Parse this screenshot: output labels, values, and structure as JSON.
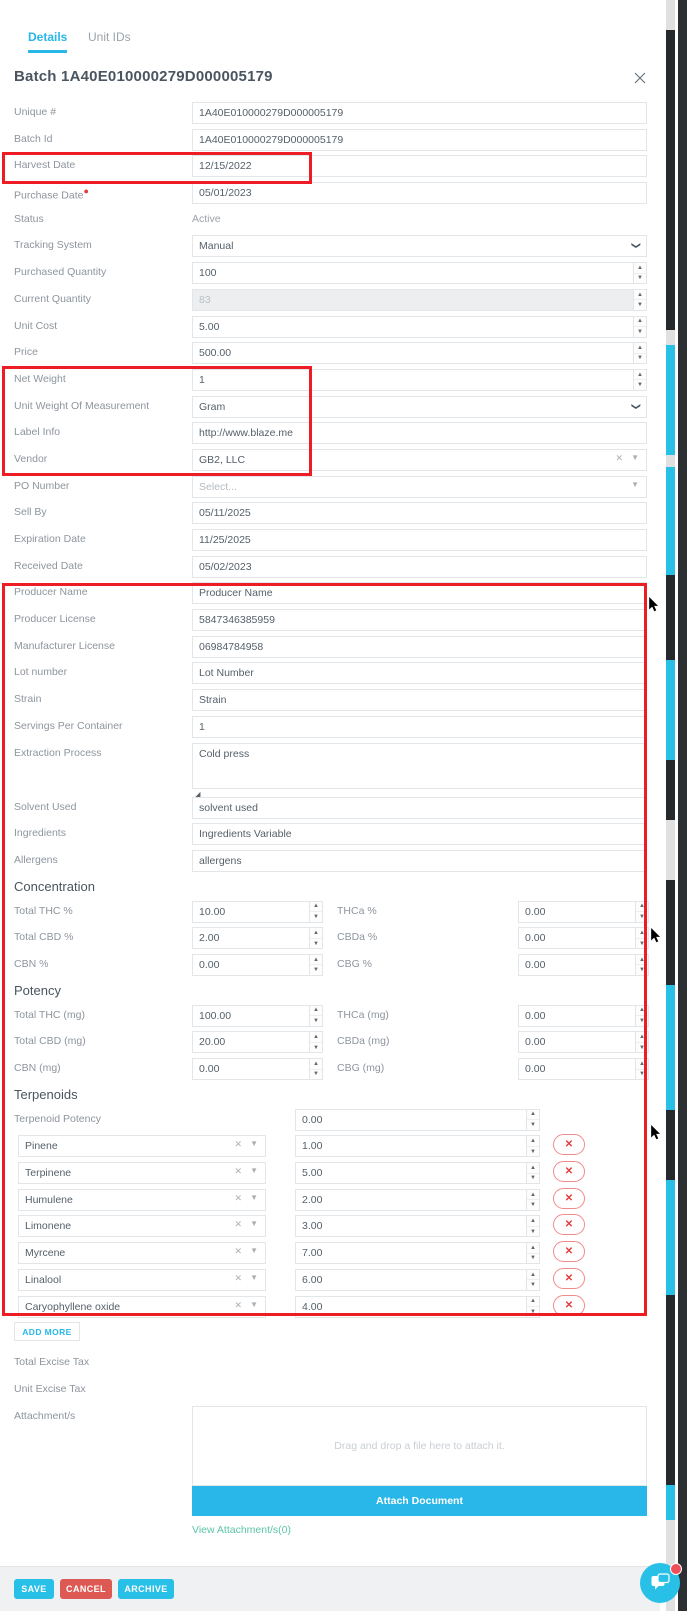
{
  "tabs": [
    {
      "label": "Details",
      "active": true
    },
    {
      "label": "Unit IDs",
      "active": false
    }
  ],
  "header": {
    "title": "Batch 1A40E010000279D000005179",
    "close_icon": "close-icon"
  },
  "fields": [
    {
      "label": "Unique #",
      "value": "1A40E010000279D000005179",
      "type": "text"
    },
    {
      "label": "Batch Id",
      "value": "1A40E010000279D000005179",
      "type": "text"
    },
    {
      "label": "Harvest Date",
      "value": "12/15/2022",
      "type": "text"
    },
    {
      "label": "Purchase Date",
      "value": "05/01/2023",
      "type": "text",
      "required": true
    },
    {
      "label": "Status",
      "value": "Active",
      "type": "static"
    },
    {
      "label": "Tracking System",
      "value": "Manual",
      "type": "select"
    },
    {
      "label": "Purchased Quantity",
      "value": "100",
      "type": "number"
    },
    {
      "label": "Current Quantity",
      "value": "83",
      "type": "number",
      "readonly": true
    },
    {
      "label": "Unit Cost",
      "value": "5.00",
      "type": "number"
    },
    {
      "label": "Price",
      "value": "500.00",
      "type": "number"
    },
    {
      "label": "Net Weight",
      "value": "1",
      "type": "number"
    },
    {
      "label": "Unit Weight Of Measurement",
      "value": "Gram",
      "type": "select"
    },
    {
      "label": "Label Info",
      "value": "http://www.blaze.me",
      "type": "text"
    },
    {
      "label": "Vendor",
      "value": "GB2, LLC",
      "type": "select2"
    },
    {
      "label": "PO Number",
      "value": "Select...",
      "type": "select3",
      "placeholder": true
    },
    {
      "label": "Sell By",
      "value": "05/11/2025",
      "type": "text"
    },
    {
      "label": "Expiration Date",
      "value": "11/25/2025",
      "type": "text"
    },
    {
      "label": "Received Date",
      "value": "05/02/2023",
      "type": "text"
    },
    {
      "label": "Producer Name",
      "value": "Producer Name",
      "type": "text"
    },
    {
      "label": "Producer License",
      "value": "5847346385959",
      "type": "text"
    },
    {
      "label": "Manufacturer License",
      "value": "06984784958",
      "type": "text"
    },
    {
      "label": "Lot number",
      "value": "Lot Number",
      "type": "text"
    },
    {
      "label": "Strain",
      "value": "Strain",
      "type": "text"
    },
    {
      "label": "Servings Per Container",
      "value": "1",
      "type": "text"
    },
    {
      "label": "Extraction Process",
      "value": "Cold press",
      "type": "textarea"
    },
    {
      "label": "Solvent Used",
      "value": "solvent used",
      "type": "text"
    },
    {
      "label": "Ingredients",
      "value": "Ingredients Variable",
      "type": "text"
    },
    {
      "label": "Allergens",
      "value": "allergens",
      "type": "text"
    }
  ],
  "concentration": {
    "heading": "Concentration",
    "rows": [
      {
        "left_label": "Total THC %",
        "left_value": "10.00",
        "right_label": "THCa %",
        "right_value": "0.00"
      },
      {
        "left_label": "Total CBD %",
        "left_value": "2.00",
        "right_label": "CBDa %",
        "right_value": "0.00"
      },
      {
        "left_label": "CBN %",
        "left_value": "0.00",
        "right_label": "CBG %",
        "right_value": "0.00"
      }
    ]
  },
  "potency": {
    "heading": "Potency",
    "rows": [
      {
        "left_label": "Total THC (mg)",
        "left_value": "100.00",
        "right_label": "THCa (mg)",
        "right_value": "0.00"
      },
      {
        "left_label": "Total CBD (mg)",
        "left_value": "20.00",
        "right_label": "CBDa (mg)",
        "right_value": "0.00"
      },
      {
        "left_label": "CBN (mg)",
        "left_value": "0.00",
        "right_label": "CBG (mg)",
        "right_value": "0.00"
      }
    ]
  },
  "terpenoids": {
    "heading": "Terpenoids",
    "potency_label": "Terpenoid Potency",
    "potency_value": "0.00",
    "items": [
      {
        "name": "Pinene",
        "value": "1.00"
      },
      {
        "name": "Terpinene",
        "value": "5.00"
      },
      {
        "name": "Humulene",
        "value": "2.00"
      },
      {
        "name": "Limonene",
        "value": "3.00"
      },
      {
        "name": "Myrcene",
        "value": "7.00"
      },
      {
        "name": "Linalool",
        "value": "6.00"
      },
      {
        "name": "Caryophyllene oxide",
        "value": "4.00"
      }
    ],
    "add_more_label": "ADD MORE",
    "delete_icon": "close-x-icon"
  },
  "taxes": [
    {
      "label": "Total Excise Tax",
      "value": ""
    },
    {
      "label": "Unit Excise Tax",
      "value": ""
    }
  ],
  "attachments": {
    "label": "Attachment/s",
    "drop_text": "Drag and drop a file here to attach it.",
    "attach_button": "Attach Document",
    "view_link": "View Attachment/s(0)"
  },
  "footer": {
    "save": "SAVE",
    "cancel": "CANCEL",
    "archive": "ARCHIVE"
  },
  "chat": {
    "icon": "chat-bubble-icon",
    "badge": ""
  },
  "colors": {
    "accent": "#29c0e8",
    "danger": "#dd5a54",
    "highlight": "#ee1c25",
    "link": "#5cc5a6",
    "label": "#8d959d"
  }
}
